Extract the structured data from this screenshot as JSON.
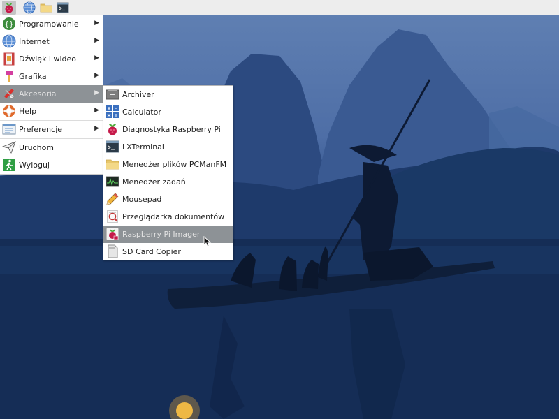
{
  "taskbar": {
    "buttons": [
      {
        "name": "raspberry-menu",
        "icon": "raspberry-icon"
      },
      {
        "name": "browser",
        "icon": "globe-icon"
      },
      {
        "name": "file-manager",
        "icon": "folder-icon"
      },
      {
        "name": "terminal",
        "icon": "terminal-icon"
      }
    ]
  },
  "main_menu": {
    "items": [
      {
        "label": "Programowanie",
        "icon": "programming-icon",
        "submenu": true
      },
      {
        "label": "Internet",
        "icon": "globe-icon",
        "submenu": true
      },
      {
        "label": "Dźwięk i wideo",
        "icon": "sound-video-icon",
        "submenu": true
      },
      {
        "label": "Grafika",
        "icon": "paintbrush-icon",
        "submenu": true
      },
      {
        "label": "Akcesoria",
        "icon": "accessories-icon",
        "submenu": true,
        "selected": true
      },
      {
        "label": "Help",
        "icon": "lifebuoy-icon",
        "submenu": true
      },
      {
        "label": "Preferencje",
        "icon": "preferences-icon",
        "submenu": true
      },
      {
        "label": "Uruchom",
        "icon": "paper-plane-icon",
        "submenu": false
      },
      {
        "label": "Wyloguj",
        "icon": "exit-icon",
        "submenu": false
      }
    ]
  },
  "sub_menu": {
    "items": [
      {
        "label": "Archiver",
        "icon": "archive-icon"
      },
      {
        "label": "Calculator",
        "icon": "calculator-icon"
      },
      {
        "label": "Diagnostyka Raspberry Pi",
        "icon": "raspberry-icon"
      },
      {
        "label": "LXTerminal",
        "icon": "terminal-icon"
      },
      {
        "label": "Menedżer plików PCManFM",
        "icon": "folder-icon"
      },
      {
        "label": "Menedżer zadań",
        "icon": "task-manager-icon"
      },
      {
        "label": "Mousepad",
        "icon": "pencil-icon"
      },
      {
        "label": "Przeglądarka dokumentów",
        "icon": "document-viewer-icon"
      },
      {
        "label": "Raspberry Pi Imager",
        "icon": "raspberry-imager-icon",
        "selected": true
      },
      {
        "label": "SD Card Copier",
        "icon": "sd-card-icon"
      }
    ]
  },
  "colors": {
    "menu_selected_bg": "#8d9296",
    "menu_selected_text": "#e3e3e3",
    "taskbar_bg": "#ededed"
  }
}
